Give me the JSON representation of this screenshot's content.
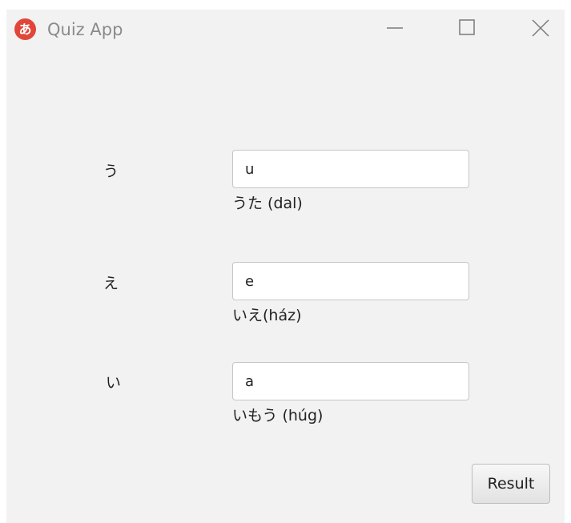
{
  "window": {
    "title": "Quiz App",
    "icon_glyph": "あ",
    "icon_color": "#e0463a",
    "controls": [
      "minimize-icon",
      "maximize-icon",
      "close-icon"
    ]
  },
  "quiz": {
    "items": [
      {
        "kana": "う",
        "answer": "u",
        "hint": "うた (dal)"
      },
      {
        "kana": "え",
        "answer": "e",
        "hint": "いえ(ház)"
      },
      {
        "kana": "い",
        "answer": "a",
        "hint": "いもう (húg)"
      }
    ]
  },
  "actions": {
    "result_label": "Result"
  }
}
